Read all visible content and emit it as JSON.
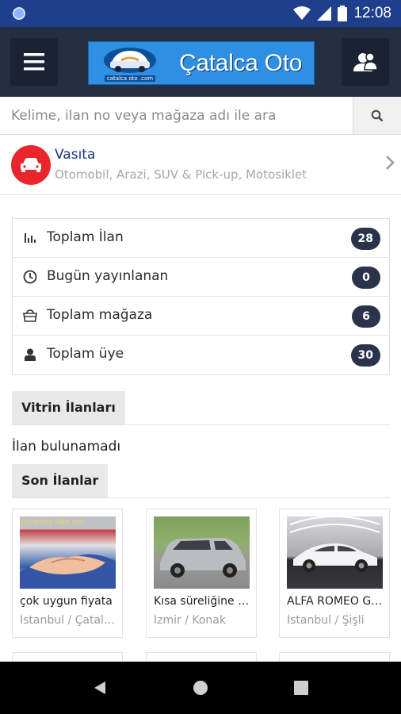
{
  "status_bar": {
    "time": "12:08"
  },
  "app_bar": {
    "logo_text": "Çatalca Oto",
    "logo_sub": "catalca oto .com"
  },
  "search": {
    "placeholder": "Kelime, ilan no veya mağaza adı ile ara"
  },
  "category": {
    "title": "Vasıta",
    "subtitle": "Otomobil, Arazi, SUV & Pick-up, Motosiklet"
  },
  "stats": [
    {
      "label": "Toplam İlan",
      "count": "28",
      "icon": "bar-chart-icon"
    },
    {
      "label": "Bugün yayınlanan",
      "count": "0",
      "icon": "clock-icon"
    },
    {
      "label": "Toplam mağaza",
      "count": "6",
      "icon": "shopping-bag-icon"
    },
    {
      "label": "Toplam üye",
      "count": "30",
      "icon": "user-icon"
    }
  ],
  "showcase": {
    "title": "Vitrin İlanları",
    "empty_text": "İlan bulunamadı"
  },
  "latest": {
    "title": "Son İlanlar",
    "listings": [
      {
        "title": "çok uygun fiyata",
        "location": "İstanbul / Çatalca",
        "thumb_text": "ücretsiz ilan ver"
      },
      {
        "title": "Kısa süreliğine satılık",
        "location": "İzmir / Konak"
      },
      {
        "title": "ALFA ROMEO GIULIA",
        "location": "İstanbul / Şişli"
      }
    ]
  },
  "colors": {
    "status_bar": "#1f3f8c",
    "app_bar": "#252f43",
    "category_red": "#e8262b",
    "badge": "#2a3349",
    "link_blue": "#1b2f86"
  }
}
